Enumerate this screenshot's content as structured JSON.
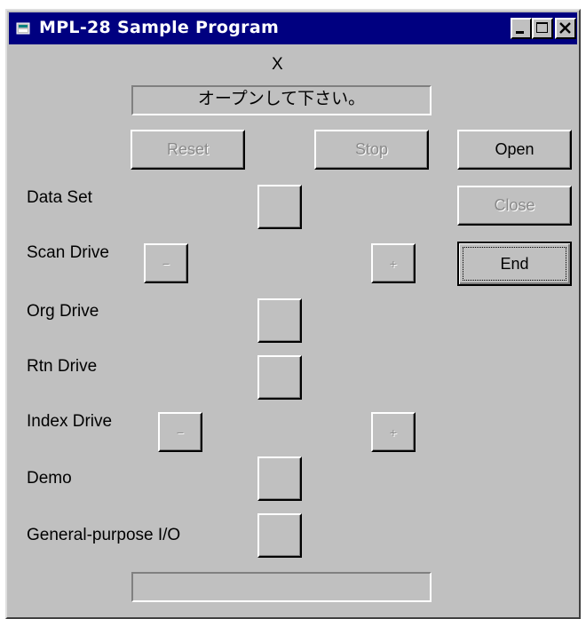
{
  "window": {
    "title": "MPL-28 Sample Program",
    "icon": "app-icon",
    "controls": [
      "minimize-icon",
      "maximize-icon",
      "close-icon"
    ]
  },
  "status": {
    "x_label": "X",
    "message": "オープンして下さい。",
    "bottom_value": ""
  },
  "buttons": {
    "reset": "Reset",
    "stop": "Stop",
    "open": "Open",
    "close": "Close",
    "end": "End",
    "minus": "−",
    "plus": "+"
  },
  "labels": {
    "data_set": "Data Set",
    "scan_drive": "Scan Drive",
    "org_drive": "Org Drive",
    "rtn_drive": "Rtn Drive",
    "index_drive": "Index Drive",
    "demo": "Demo",
    "gp_io": "General-purpose I/O"
  },
  "colors": {
    "titlebar": "#000080",
    "face": "#c0c0c0",
    "disabled_text": "#8a8a8a"
  }
}
